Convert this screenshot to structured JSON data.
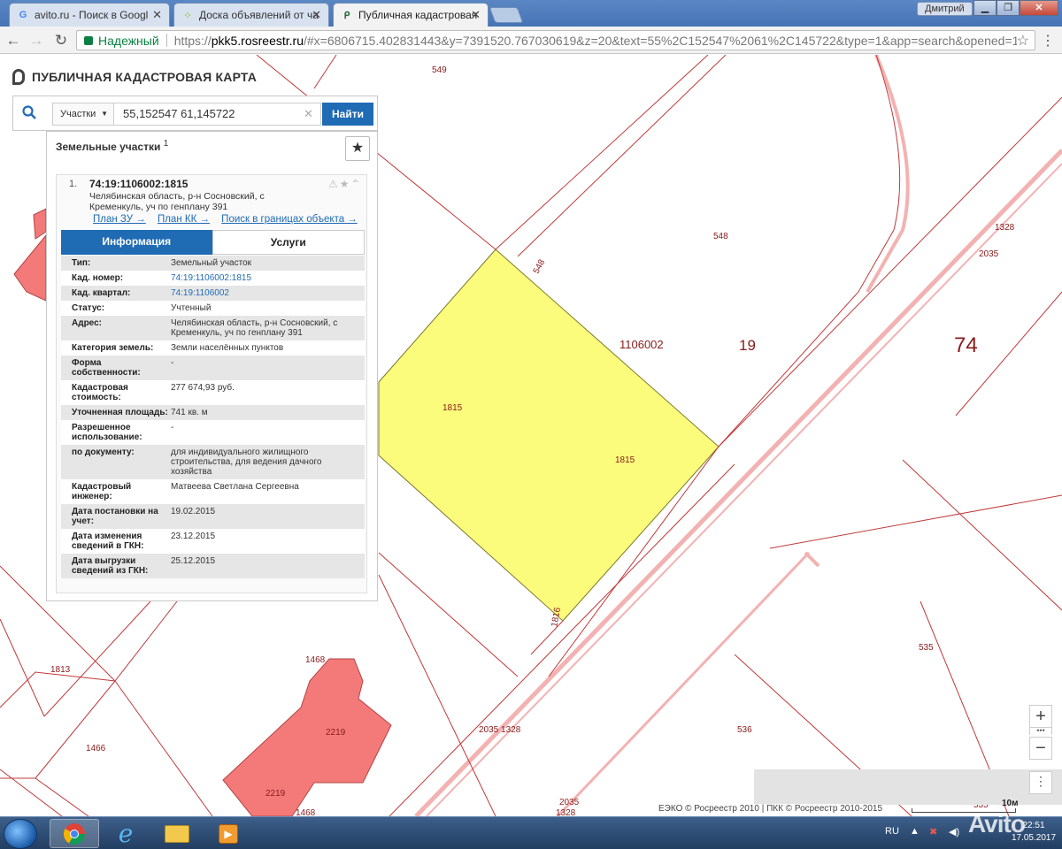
{
  "browser": {
    "tabs": [
      {
        "title": "avito.ru - Поиск в Googl",
        "icon": "google-icon",
        "favicon_char": "G",
        "favicon_color": "#4285f4"
      },
      {
        "title": "Доска объявлений от ча",
        "icon": "avito-icon",
        "favicon_char": "⁘",
        "favicon_color": "#97cf26"
      },
      {
        "title": "Публичная кадастровая",
        "icon": "pkk-icon",
        "favicon_char": "ᑭ",
        "favicon_color": "#2a6f3f"
      }
    ],
    "user": "Дмитрий",
    "secure_label": "Надежный",
    "url_scheme": "https://",
    "url_host": "pkk5.rosreestr.ru",
    "url_rest": "/#x=6806715.402831443&y=7391520.767030619&z=20&text=55%2C152547%2061%2C145722&type=1&app=search&opened=1"
  },
  "app": {
    "title": "ПУБЛИЧНАЯ КАДАСТРОВАЯ КАРТА"
  },
  "search": {
    "scope": "Участки",
    "query": "55,152547 61,145722",
    "button": "Найти"
  },
  "panel": {
    "heading": "Земельные участки",
    "count": "1",
    "result": {
      "index": "1.",
      "cad_number": "74:19:1106002:1815",
      "address": "Челябинская область, р-н Сосновский, с Кременкуль, уч по генплану 391",
      "links": [
        "План ЗУ →",
        "План КК →",
        "Поиск в границах объекта →"
      ],
      "tabs": [
        "Информация",
        "Услуги"
      ],
      "rows": [
        {
          "key": "Тип:",
          "value": "Земельный участок",
          "link": false
        },
        {
          "key": "Кад. номер:",
          "value": "74:19:1106002:1815",
          "link": true
        },
        {
          "key": "Кад. квартал:",
          "value": "74:19:1106002",
          "link": true
        },
        {
          "key": "Статус:",
          "value": "Учтенный",
          "link": false
        },
        {
          "key": "Адрес:",
          "value": "Челябинская область, р-н Сосновский, с Кременкуль, уч по генплану 391",
          "link": false
        },
        {
          "key": "Категория земель:",
          "value": "Земли населённых пунктов",
          "link": false
        },
        {
          "key": "Форма собственности:",
          "value": "-",
          "link": false
        },
        {
          "key": "Кадастровая стоимость:",
          "value": "277 674,93 руб.",
          "link": false
        },
        {
          "key": "Уточненная площадь:",
          "value": "741 кв. м",
          "link": false
        },
        {
          "key": "Разрешенное использование:",
          "value": "-",
          "link": false
        },
        {
          "key": "по документу:",
          "value": "для индивидуального жилищного строительства, для ведения дачного хозяйства",
          "link": false
        },
        {
          "key": "Кадастровый инженер:",
          "value": "Матвеева Светлана Сергеевна",
          "link": false
        },
        {
          "key": "Дата постановки на учет:",
          "value": "19.02.2015",
          "link": false
        },
        {
          "key": "Дата изменения сведений в ГКН:",
          "value": "23.12.2015",
          "link": false
        },
        {
          "key": "Дата выгрузки сведений из ГКН:",
          "value": "25.12.2015",
          "link": false
        }
      ]
    }
  },
  "map": {
    "labels": {
      "p549": "549",
      "p548": "548",
      "p548b": "548",
      "p1328a": "1328",
      "p2035a": "2035",
      "quarter": "1106002",
      "district": "19",
      "region": "74",
      "p1815a": "1815",
      "p1815b": "1815",
      "p1816": "1816",
      "p1813": "1813",
      "p1468a": "1468",
      "p2219a": "2219",
      "p2219b": "2219",
      "p1466": "1466",
      "p1468b": "1468",
      "p2035_1328": "2035 1328",
      "p536": "536",
      "p535": "535",
      "p535b": "535",
      "p2035b": "2035",
      "p1328b": "1328"
    },
    "copyright": "ЕЭКО © Росреестр 2010 | ПКК © Росреестр 2010-2015",
    "scale": "10м",
    "selected_color": "#fbfb7c",
    "building_color": "#f47a7a",
    "line_color": "#c0393b"
  },
  "taskbar": {
    "lang": "RU",
    "time": "22:51",
    "date": "17.05.2017",
    "watermark": "Avito"
  }
}
